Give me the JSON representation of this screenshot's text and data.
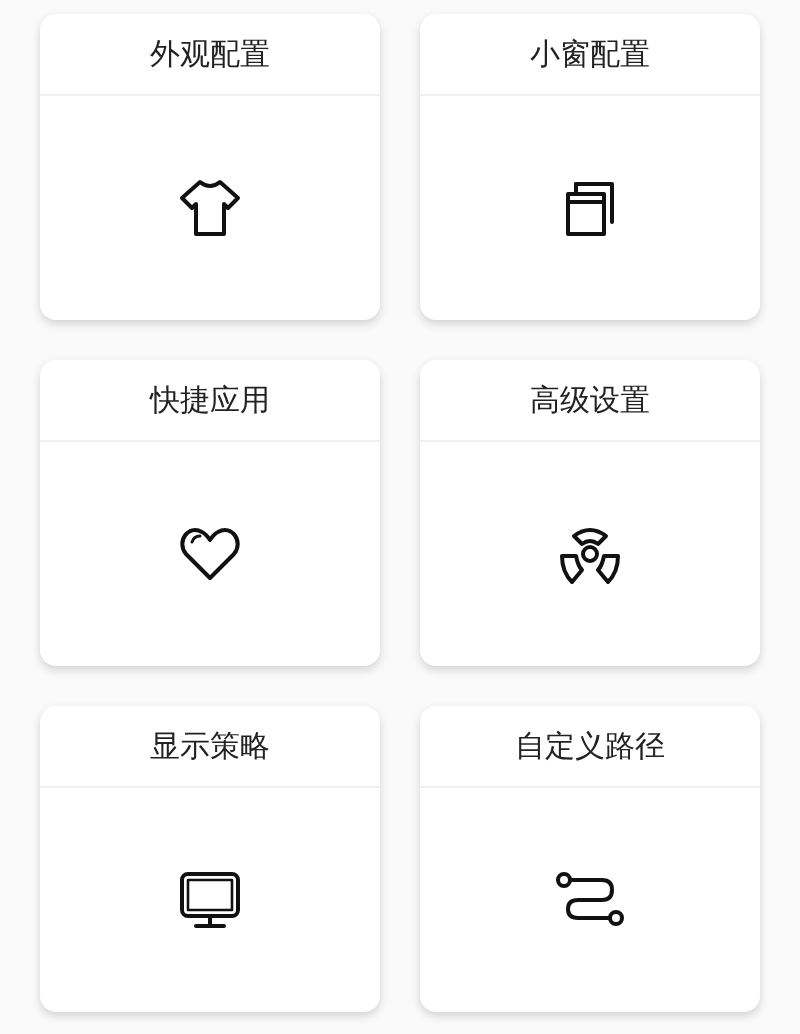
{
  "cards": [
    {
      "title": "外观配置"
    },
    {
      "title": "小窗配置"
    },
    {
      "title": "快捷应用"
    },
    {
      "title": "高级设置"
    },
    {
      "title": "显示策略"
    },
    {
      "title": "自定义路径"
    }
  ]
}
